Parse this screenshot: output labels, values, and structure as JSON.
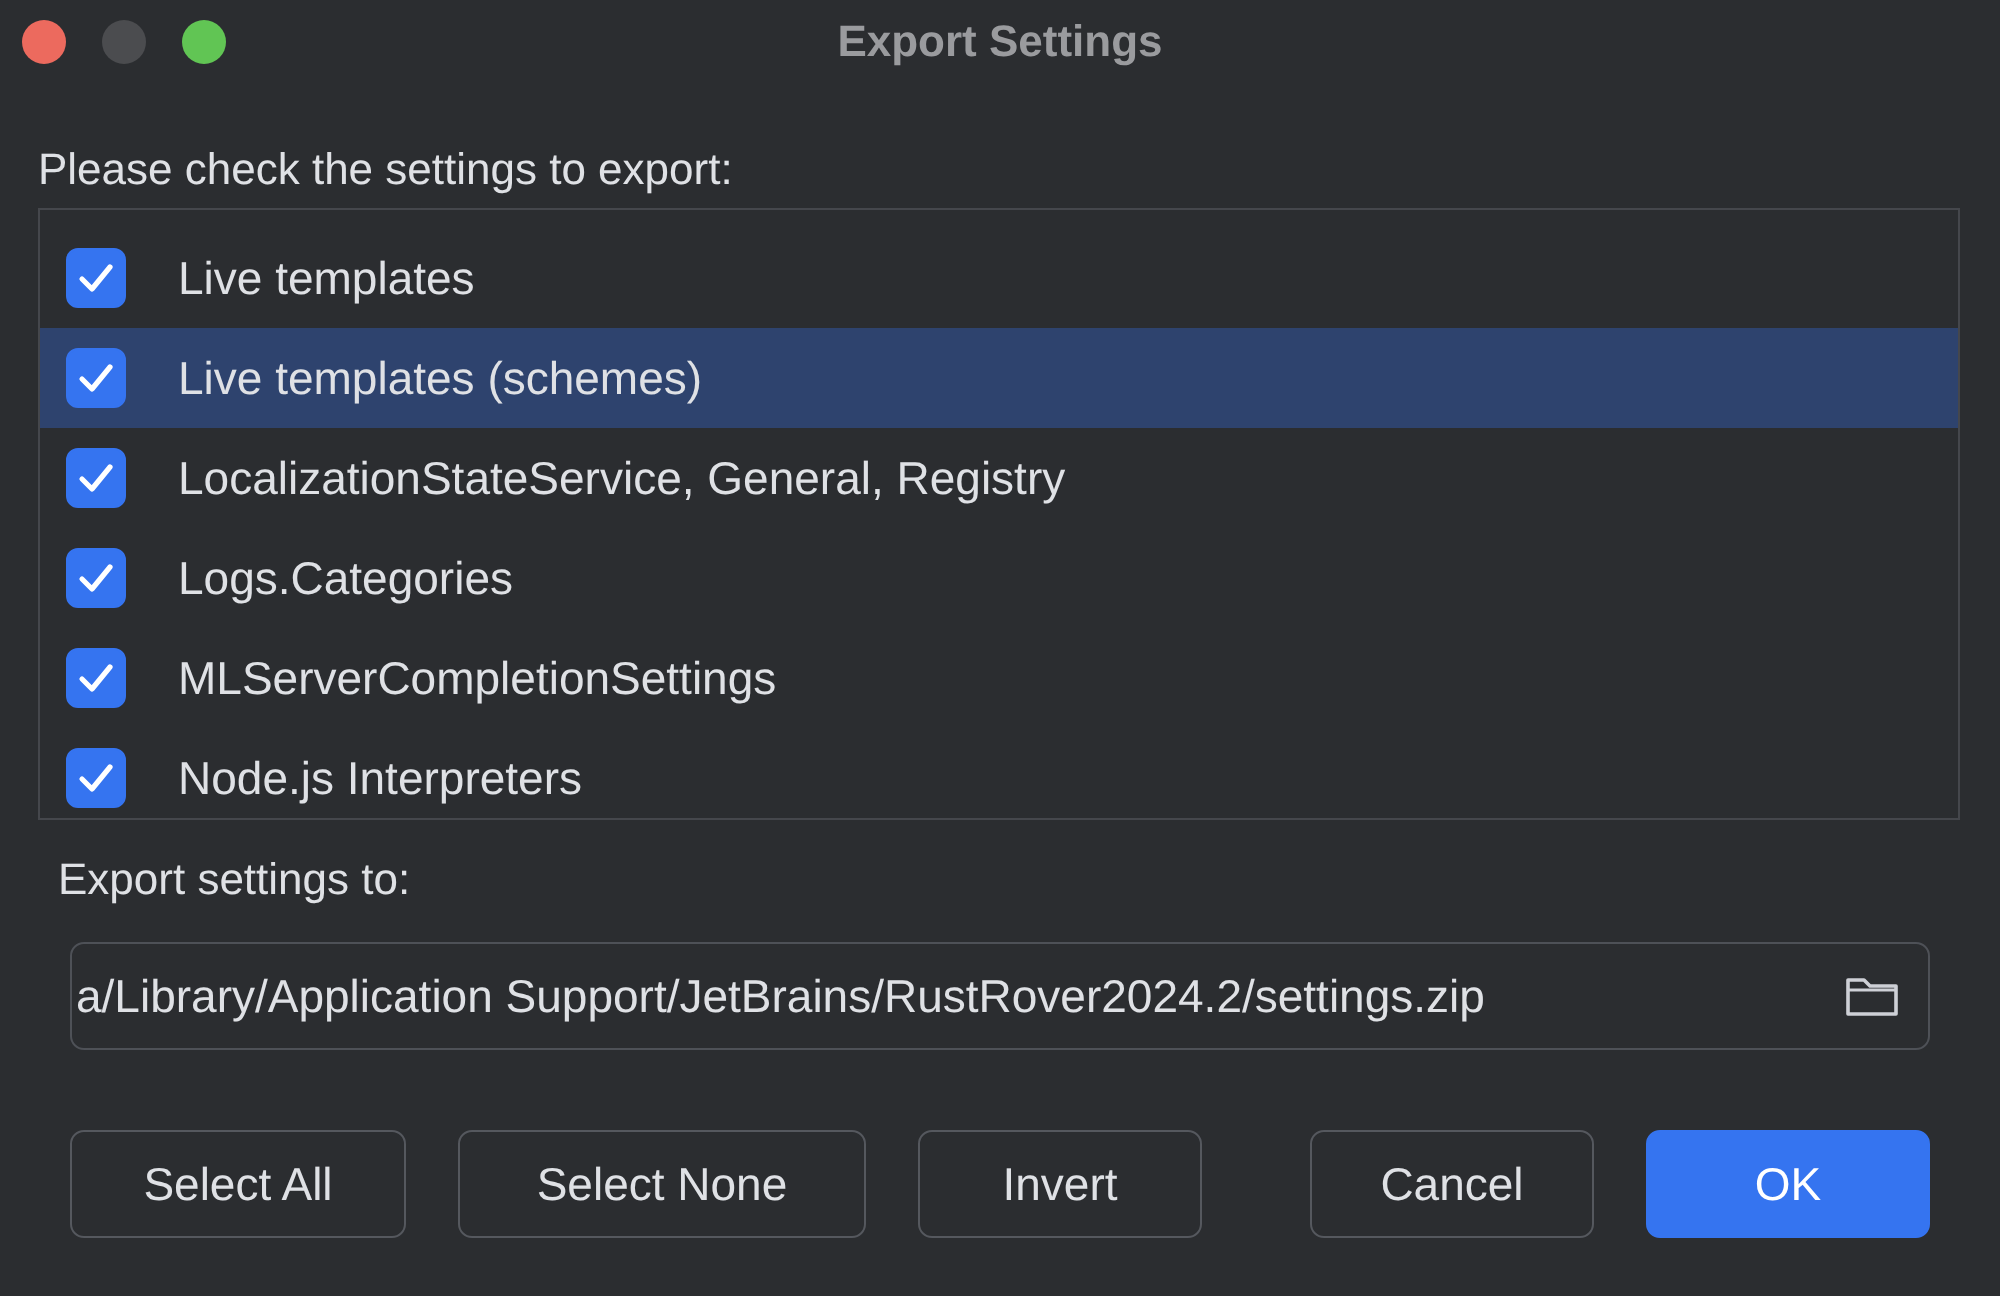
{
  "window": {
    "title": "Export Settings"
  },
  "prompt": "Please check the settings to export:",
  "settings": [
    {
      "label": "Live templates",
      "checked": true,
      "selected": false
    },
    {
      "label": "Live templates (schemes)",
      "checked": true,
      "selected": true
    },
    {
      "label": "LocalizationStateService, General, Registry",
      "checked": true,
      "selected": false
    },
    {
      "label": "Logs.Categories",
      "checked": true,
      "selected": false
    },
    {
      "label": "MLServerCompletionSettings",
      "checked": true,
      "selected": false
    },
    {
      "label": "Node.js Interpreters",
      "checked": true,
      "selected": false
    }
  ],
  "export_label": "Export settings to:",
  "path": {
    "value": "a/Library/Application Support/JetBrains/RustRover2024.2/settings.zip"
  },
  "buttons": [
    {
      "label": "Select All",
      "kind": "secondary"
    },
    {
      "label": "Select None",
      "kind": "secondary"
    },
    {
      "label": "Invert",
      "kind": "secondary"
    },
    {
      "label": "Cancel",
      "kind": "secondary"
    },
    {
      "label": "OK",
      "kind": "primary"
    }
  ]
}
